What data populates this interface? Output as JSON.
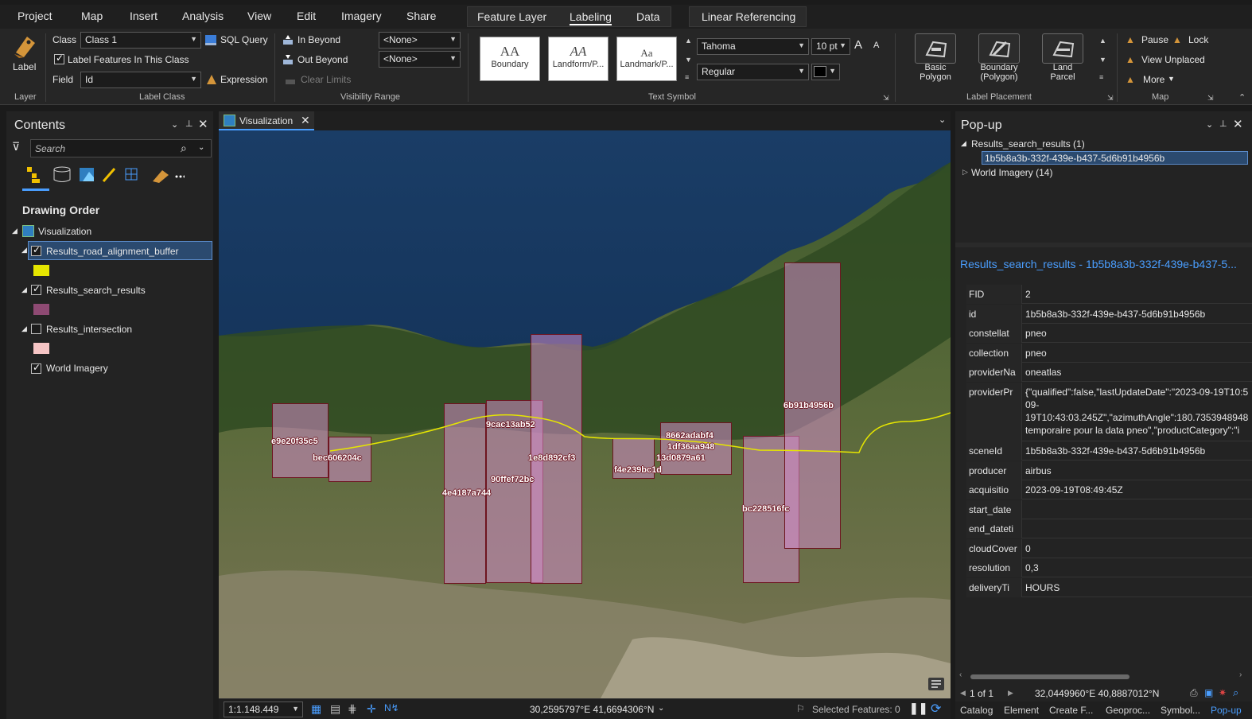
{
  "menu": {
    "tabs": [
      "Project",
      "Map",
      "Insert",
      "Analysis",
      "View",
      "Edit",
      "Imagery",
      "Share"
    ],
    "context_tabs": [
      "Feature Layer",
      "Labeling",
      "Data"
    ],
    "active": "Labeling",
    "linear": "Linear Referencing"
  },
  "ribbon": {
    "layer": {
      "button": "Label",
      "group": "Layer"
    },
    "label_class": {
      "class_label": "Class",
      "class_value": "Class 1",
      "sql_query": "SQL Query",
      "label_features": "Label Features In This Class",
      "field_label": "Field",
      "field_value": "Id",
      "expression": "Expression",
      "group": "Label Class"
    },
    "visibility": {
      "in_beyond": "In Beyond",
      "out_beyond": "Out Beyond",
      "clear_limits": "Clear Limits",
      "none1": "<None>",
      "none2": "<None>",
      "group": "Visibility Range"
    },
    "text_symbol": {
      "gallery": [
        {
          "big": "AA",
          "label": "Boundary"
        },
        {
          "big": "AA",
          "label": "Landform/P..."
        },
        {
          "big": "Aa",
          "label": "Landmark/P..."
        }
      ],
      "font": "Tahoma",
      "size": "10 pt",
      "style": "Regular",
      "grow": "A",
      "shrink": "A",
      "group": "Text Symbol"
    },
    "placement": {
      "items": [
        {
          "l1": "Basic",
          "l2": "Polygon"
        },
        {
          "l1": "Boundary",
          "l2": "(Polygon)"
        },
        {
          "l1": "Land",
          "l2": "Parcel"
        }
      ],
      "group": "Label Placement"
    },
    "map": {
      "pause": "Pause",
      "lock": "Lock",
      "view_unplaced": "View Unplaced",
      "more": "More",
      "group": "Map"
    }
  },
  "contents": {
    "title": "Contents",
    "search_placeholder": "Search",
    "drawing_order": "Drawing Order",
    "map_name": "Visualization",
    "layers": [
      {
        "name": "Results_road_alignment_buffer",
        "checked": true,
        "color": "#e6e600"
      },
      {
        "name": "Results_search_results",
        "checked": true,
        "color": "#8e4a73"
      },
      {
        "name": "Results_intersection",
        "checked": false,
        "color": "#f6c5c5"
      },
      {
        "name": "World Imagery",
        "checked": true
      }
    ]
  },
  "map": {
    "tab": "Visualization",
    "scale": "1:1.148.449",
    "coords": "30,2595797°E 41,6694306°N",
    "selected": "Selected Features: 0",
    "labels": [
      "e9e20f35c5",
      "bec606204c",
      "9cac13ab52",
      "1e8d892cf3",
      "90ffef72bc",
      "4e4187a744",
      "f4e239bc1d",
      "8662adabf4",
      "1df36aa948",
      "13d0879a61",
      "6b91b4956b",
      "bc228516fc"
    ]
  },
  "popup": {
    "title": "Pop-up",
    "group1": "Results_search_results (1)",
    "selected_id": "1b5b8a3b-332f-439e-b437-5d6b91b4956b",
    "group2": "World Imagery (14)",
    "header": "Results_search_results - 1b5b8a3b-332f-439e-b437-5...",
    "rows": [
      {
        "k": "FID",
        "v": "2"
      },
      {
        "k": "id",
        "v": "1b5b8a3b-332f-439e-b437-5d6b91b4956b"
      },
      {
        "k": "constellat",
        "v": "pneo"
      },
      {
        "k": "collection",
        "v": "pneo"
      },
      {
        "k": "providerNa",
        "v": "oneatlas"
      },
      {
        "k": "providerPr",
        "v": "{\"qualified\":false,\"lastUpdateDate\":\"2023-09-19T10:5",
        "v2": "09-",
        "v3": "19T10:43:03.245Z\",\"azimuthAngle\":180.7353948948",
        "v4": "temporaire pour la data pneo\",\"productCategory\":\"i"
      },
      {
        "k": "sceneId",
        "v": "1b5b8a3b-332f-439e-b437-5d6b91b4956b"
      },
      {
        "k": "producer",
        "v": "airbus"
      },
      {
        "k": "acquisitio",
        "v": "2023-09-19T08:49:45Z"
      },
      {
        "k": "start_date",
        "v": ""
      },
      {
        "k": "end_dateti",
        "v": ""
      },
      {
        "k": "cloudCover",
        "v": "0"
      },
      {
        "k": "resolution",
        "v": "0,3"
      },
      {
        "k": "deliveryTi",
        "v": "HOURS"
      }
    ],
    "nav": "1 of 1",
    "coords": "32,0449960°E 40,8887012°N"
  },
  "bottom_tabs": [
    "Catalog",
    "Element",
    "Create F...",
    "Geoproc...",
    "Symbol...",
    "Pop-up"
  ]
}
